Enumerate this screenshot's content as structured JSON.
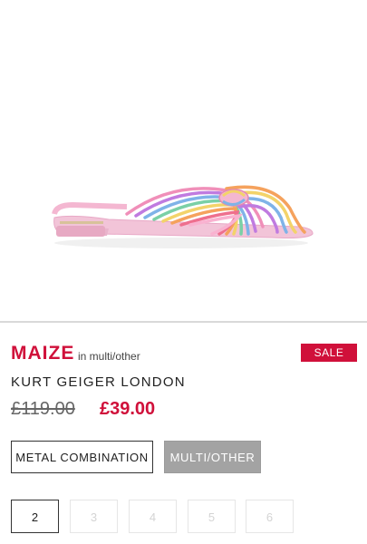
{
  "product": {
    "name": "MAIZE",
    "colour_label": "in multi/other",
    "sale_badge": "SALE",
    "brand": "KURT GEIGER LONDON",
    "old_price": "£119.00",
    "new_price": "£39.00"
  },
  "variants": [
    {
      "label": "METAL COMBINATION",
      "selected": false
    },
    {
      "label": "MULTI/OTHER",
      "selected": true
    }
  ],
  "sizes": [
    {
      "label": "2",
      "available": true,
      "selected": true
    },
    {
      "label": "3",
      "available": false
    },
    {
      "label": "4",
      "available": false
    },
    {
      "label": "5",
      "available": false
    },
    {
      "label": "6",
      "available": false
    }
  ],
  "colors": {
    "accent": "#d0103a",
    "selected_variant_bg": "#a3a3a3"
  }
}
